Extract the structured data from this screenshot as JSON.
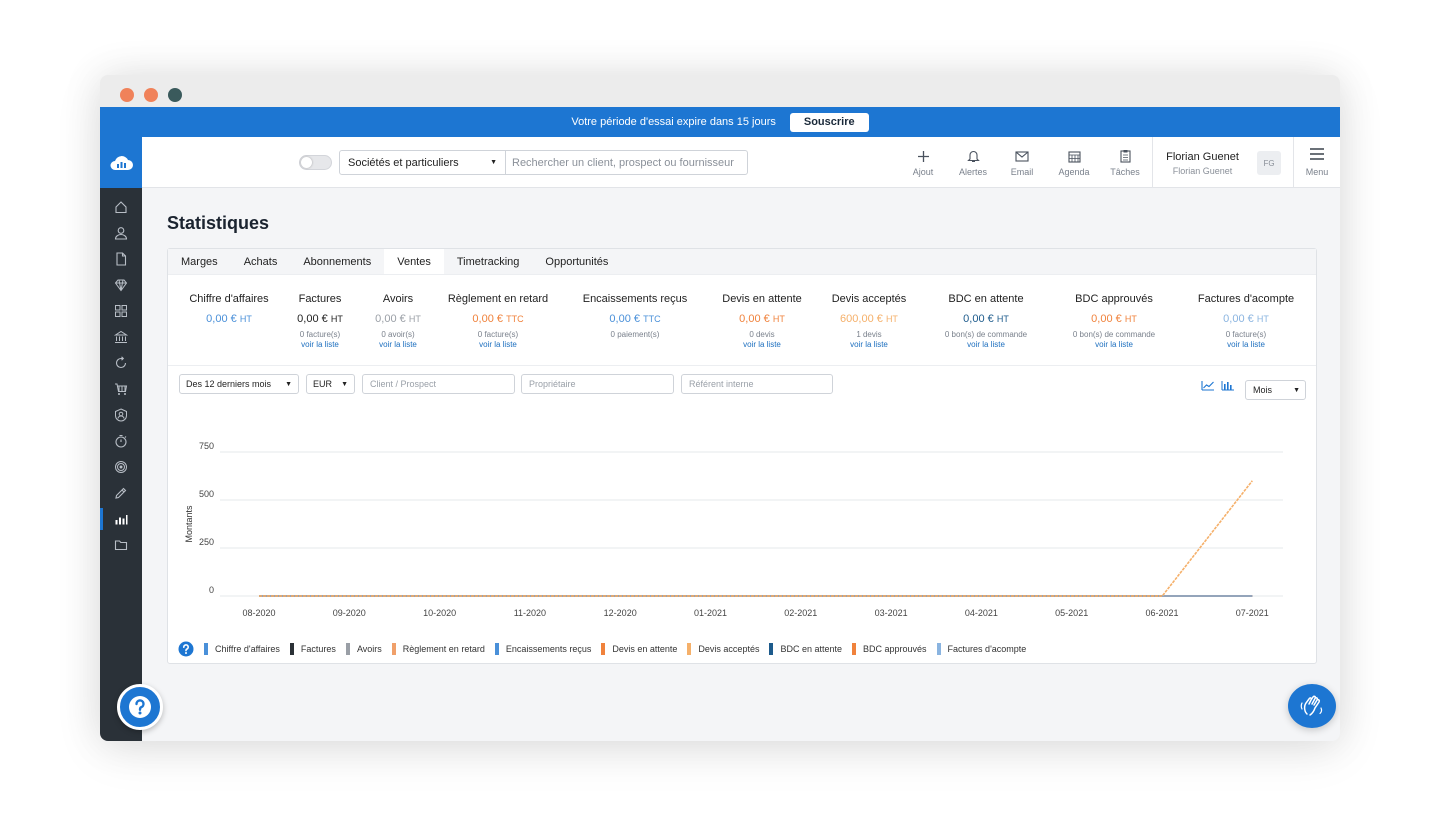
{
  "trial": {
    "message": "Votre période d'essai expire dans 15 jours",
    "subscribe": "Souscrire"
  },
  "search": {
    "scope": "Sociétés et particuliers",
    "placeholder": "Rechercher un client, prospect ou fournisseur"
  },
  "toolbar": {
    "add": "Ajout",
    "alerts": "Alertes",
    "email": "Email",
    "agenda": "Agenda",
    "tasks": "Tâches",
    "menu": "Menu"
  },
  "user": {
    "name": "Florian Guenet",
    "sub": "Florian Guenet",
    "initials": "FG"
  },
  "sidebar": {
    "icons": [
      "home-icon",
      "user-icon",
      "document-icon",
      "diamond-icon",
      "grid-icon",
      "bank-icon",
      "refresh-icon",
      "cart-icon",
      "badge-icon",
      "stopwatch-icon",
      "target-icon",
      "pen-icon",
      "stats-icon",
      "folder-icon"
    ],
    "active_index": 12
  },
  "page": {
    "title": "Statistiques"
  },
  "tabs": [
    "Marges",
    "Achats",
    "Abonnements",
    "Ventes",
    "Timetracking",
    "Opportunités"
  ],
  "active_tab": "Ventes",
  "kpis": [
    {
      "title": "Chiffre d'affaires",
      "value": "0,00 €",
      "unit": "HT",
      "color": "#4a90d9",
      "sub": "",
      "link": ""
    },
    {
      "title": "Factures",
      "value": "0,00 €",
      "unit": "HT",
      "color": "#222222",
      "sub": "0 facture(s)",
      "link": "voir la liste"
    },
    {
      "title": "Avoirs",
      "value": "0,00 €",
      "unit": "HT",
      "color": "#9a9fa6",
      "sub": "0 avoir(s)",
      "link": "voir la liste"
    },
    {
      "title": "Règlement en retard",
      "value": "0,00 €",
      "unit": "TTC",
      "color": "#f0823c",
      "sub": "0 facture(s)",
      "link": "voir la liste"
    },
    {
      "title": "Encaissements reçus",
      "value": "0,00 €",
      "unit": "TTC",
      "color": "#4a90d9",
      "sub": "0 paiement(s)",
      "link": ""
    },
    {
      "title": "Devis en attente",
      "value": "0,00 €",
      "unit": "HT",
      "color": "#f0823c",
      "sub": "0 devis",
      "link": "voir la liste"
    },
    {
      "title": "Devis acceptés",
      "value": "600,00 €",
      "unit": "HT",
      "color": "#f5b06a",
      "sub": "1 devis",
      "link": "voir la liste"
    },
    {
      "title": "BDC en attente",
      "value": "0,00 €",
      "unit": "HT",
      "color": "#1d5b8c",
      "sub": "0 bon(s) de commande",
      "link": "voir la liste"
    },
    {
      "title": "BDC approuvés",
      "value": "0,00 €",
      "unit": "HT",
      "color": "#f0823c",
      "sub": "0 bon(s) de commande",
      "link": "voir la liste"
    },
    {
      "title": "Factures d'acompte",
      "value": "0,00 €",
      "unit": "HT",
      "color": "#8ab4e0",
      "sub": "0 facture(s)",
      "link": "voir la liste"
    }
  ],
  "filters": {
    "period": "Des 12 derniers mois",
    "currency": "EUR",
    "client_placeholder": "Client / Prospect",
    "owner_placeholder": "Propriétaire",
    "ref_placeholder": "Référent interne",
    "granularity": "Mois"
  },
  "chart_data": {
    "type": "line",
    "ylabel": "Montants",
    "ylim": [
      0,
      750
    ],
    "yticks": [
      0,
      250,
      500,
      750
    ],
    "categories": [
      "08-2020",
      "09-2020",
      "10-2020",
      "11-2020",
      "12-2020",
      "01-2021",
      "02-2021",
      "03-2021",
      "04-2021",
      "05-2021",
      "06-2021",
      "07-2021"
    ],
    "grid": true,
    "series": [
      {
        "name": "Chiffre d'affaires",
        "color": "#4a90d9",
        "values": [
          0,
          0,
          0,
          0,
          0,
          0,
          0,
          0,
          0,
          0,
          0,
          0
        ]
      },
      {
        "name": "Factures",
        "color": "#2b3136",
        "values": [
          0,
          0,
          0,
          0,
          0,
          0,
          0,
          0,
          0,
          0,
          0,
          0
        ]
      },
      {
        "name": "Avoirs",
        "color": "#9a9fa6",
        "values": [
          0,
          0,
          0,
          0,
          0,
          0,
          0,
          0,
          0,
          0,
          0,
          0
        ]
      },
      {
        "name": "Règlement en retard",
        "color": "#f0a06a",
        "values": [
          0,
          0,
          0,
          0,
          0,
          0,
          0,
          0,
          0,
          0,
          0,
          0
        ]
      },
      {
        "name": "Encaissements reçus",
        "color": "#4a90d9",
        "values": [
          0,
          0,
          0,
          0,
          0,
          0,
          0,
          0,
          0,
          0,
          0,
          0
        ]
      },
      {
        "name": "Devis en attente",
        "color": "#f0823c",
        "values": [
          0,
          0,
          0,
          0,
          0,
          0,
          0,
          0,
          0,
          0,
          0,
          0
        ]
      },
      {
        "name": "Devis acceptés",
        "color": "#f5b06a",
        "values": [
          0,
          0,
          0,
          0,
          0,
          0,
          0,
          0,
          0,
          0,
          0,
          600
        ]
      },
      {
        "name": "BDC en attente",
        "color": "#1d5b8c",
        "values": [
          0,
          0,
          0,
          0,
          0,
          0,
          0,
          0,
          0,
          0,
          0,
          0
        ]
      },
      {
        "name": "BDC approuvés",
        "color": "#f0823c",
        "values": [
          0,
          0,
          0,
          0,
          0,
          0,
          0,
          0,
          0,
          0,
          0,
          0
        ]
      },
      {
        "name": "Factures d'acompte",
        "color": "#8ab4e0",
        "values": [
          0,
          0,
          0,
          0,
          0,
          0,
          0,
          0,
          0,
          0,
          0,
          0
        ]
      }
    ]
  }
}
